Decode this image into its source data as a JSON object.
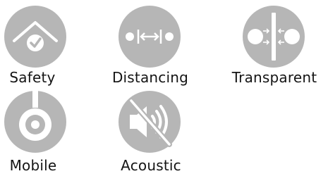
{
  "colors": {
    "icon_fill": "#b6b6b6",
    "icon_glyph": "#ffffff",
    "label_text": "#141414"
  },
  "features": [
    {
      "label": "Safety",
      "icon": "house-check-icon"
    },
    {
      "label": "Distancing",
      "icon": "distance-arrows-icon"
    },
    {
      "label": "Transparent",
      "icon": "transparent-divider-icon"
    },
    {
      "label": "Mobile",
      "icon": "mobile-stand-icon"
    },
    {
      "label": "Acoustic",
      "icon": "speaker-muted-icon"
    }
  ]
}
